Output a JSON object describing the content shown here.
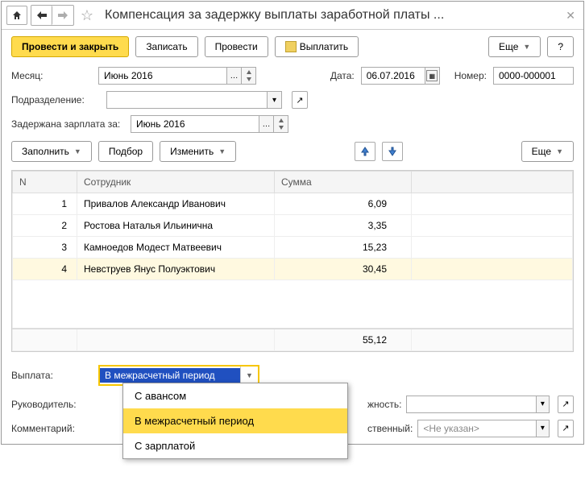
{
  "title": "Компенсация за задержку выплаты заработной платы ...",
  "toolbar": {
    "post_close": "Провести и закрыть",
    "write": "Записать",
    "post": "Провести",
    "pay": "Выплатить",
    "more": "Еще",
    "help": "?"
  },
  "fields": {
    "month_label": "Месяц:",
    "month_value": "Июнь 2016",
    "date_label": "Дата:",
    "date_value": "06.07.2016",
    "number_label": "Номер:",
    "number_value": "0000-000001",
    "dept_label": "Подразделение:",
    "dept_value": "",
    "delayed_label": "Задержана зарплата за:",
    "delayed_value": "Июнь 2016"
  },
  "table_toolbar": {
    "fill": "Заполнить",
    "select": "Подбор",
    "edit": "Изменить",
    "more": "Еще"
  },
  "table": {
    "headers": {
      "n": "N",
      "employee": "Сотрудник",
      "sum": "Сумма"
    },
    "rows": [
      {
        "n": "1",
        "employee": "Привалов Александр Иванович",
        "sum": "6,09"
      },
      {
        "n": "2",
        "employee": "Ростова Наталья Ильинична",
        "sum": "3,35"
      },
      {
        "n": "3",
        "employee": "Камноедов Модест Матвеевич",
        "sum": "15,23"
      },
      {
        "n": "4",
        "employee": "Невструев Янус Полуэктович",
        "sum": "30,45"
      }
    ],
    "total": "55,12"
  },
  "payment": {
    "label": "Выплата:",
    "selected": "В межрасчетный период",
    "options": [
      "С авансом",
      "В межрасчетный период",
      "С зарплатой"
    ]
  },
  "leader_label": "Руководитель:",
  "comment_label": "Комментарий:",
  "position_label": "жность:",
  "responsible_label": "ственный:",
  "responsible_value": "<Не указан>"
}
